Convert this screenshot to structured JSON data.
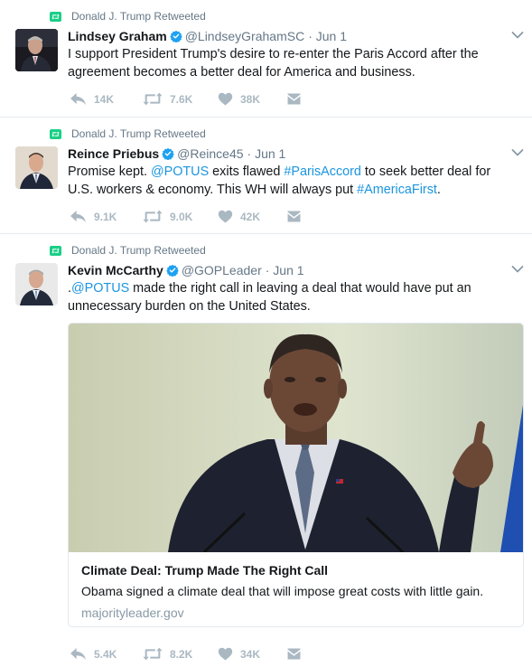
{
  "tweets": [
    {
      "retweeter": "Donald J. Trump Retweeted",
      "name": "Lindsey Graham",
      "handle": "@LindseyGrahamSC",
      "date": "· Jun 1",
      "text": "I support President Trump's desire to re-enter the Paris Accord after the agreement becomes a better deal for America and business.",
      "replies": "14K",
      "retweets": "7.6K",
      "likes": "38K"
    },
    {
      "retweeter": "Donald J. Trump Retweeted",
      "name": "Reince Priebus",
      "handle": "@Reince45",
      "date": "· Jun 1",
      "text_parts": [
        "Promise kept. ",
        "@POTUS",
        " exits flawed ",
        "#ParisAccord",
        " to seek better deal for U.S. workers & economy. This WH will always put ",
        "#AmericaFirst",
        "."
      ],
      "replies": "9.1K",
      "retweets": "9.0K",
      "likes": "42K"
    },
    {
      "retweeter": "Donald J. Trump Retweeted",
      "name": "Kevin McCarthy",
      "handle": "@GOPLeader",
      "date": "· Jun 1",
      "text_parts": [
        ".",
        "@POTUS",
        " made the right call in leaving a deal that would have put an unnecessary burden on the United States."
      ],
      "card": {
        "title": "Climate Deal: Trump Made The Right Call",
        "description": "Obama signed a climate deal that will impose great costs with little gain.",
        "domain": "majorityleader.gov"
      },
      "replies": "5.4K",
      "retweets": "8.2K",
      "likes": "34K"
    }
  ],
  "colors": {
    "link": "#1b95e0",
    "retweet_green": "#19cf86",
    "verified": "#1da1f2",
    "muted": "#657786",
    "action": "#aab8c2"
  },
  "icons": [
    "retweet-icon",
    "verified-icon",
    "caret-down-icon",
    "reply-icon",
    "like-icon",
    "dm-icon"
  ]
}
